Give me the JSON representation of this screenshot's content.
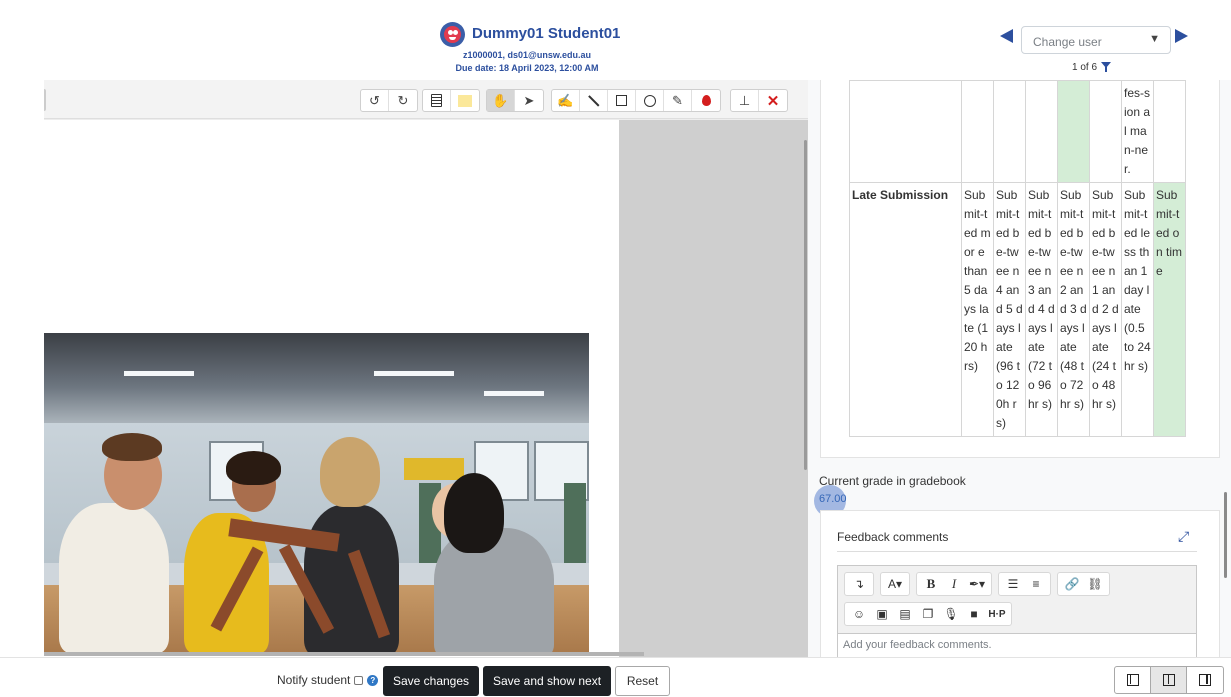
{
  "header": {
    "student_name": "Dummy01 Student01",
    "student_info": "z1000001, ds01@unsw.edu.au",
    "due_date": "Due date: 18 April 2023, 12:00 AM",
    "change_user_placeholder": "Change user",
    "count_text": "1 of 6",
    "colors": {
      "accent": "#2c4f9e"
    }
  },
  "viewer": {
    "toolbar_icons": [
      "rotate-left-icon",
      "rotate-right-icon",
      "comment-icon",
      "highlight-color-icon",
      "pan-icon",
      "select-icon",
      "stamp-pen-icon",
      "line-icon",
      "rectangle-icon",
      "oval-icon",
      "highlighter-icon",
      "pen-color-icon",
      "stamp-icon",
      "delete-icon"
    ]
  },
  "rubric": {
    "partial_row_cells": [
      "fes-sion al man-ner."
    ],
    "late_submission": {
      "criterion": "Late Submission",
      "levels": [
        "Sub mit-ted mor e than 5 days late (120 hrs)",
        "Sub mit-ted be-twee n 4 and 5 days late (96 to 120h rs)",
        "Sub mit-ted be-twee n 3 and 4 days late (72 to 96hr s)",
        "Sub mit-ted be-twee n 2 and 3 days late (48 to 72hr s)",
        "Sub mit-ted be-twee n 1 and 2 days late (24 to 48hr s)",
        "Sub mit-ted less than 1 day late (0.5 to 24hr s)",
        "Sub mit-ted on time"
      ],
      "selected_index": 6
    }
  },
  "gradebook": {
    "label": "Current grade in gradebook",
    "value": "67.00"
  },
  "feedback": {
    "title": "Feedback comments",
    "placeholder": "Add your feedback comments."
  },
  "footer": {
    "notify_label": "Notify student",
    "save_changes": "Save changes",
    "save_next": "Save and show next",
    "reset": "Reset"
  }
}
